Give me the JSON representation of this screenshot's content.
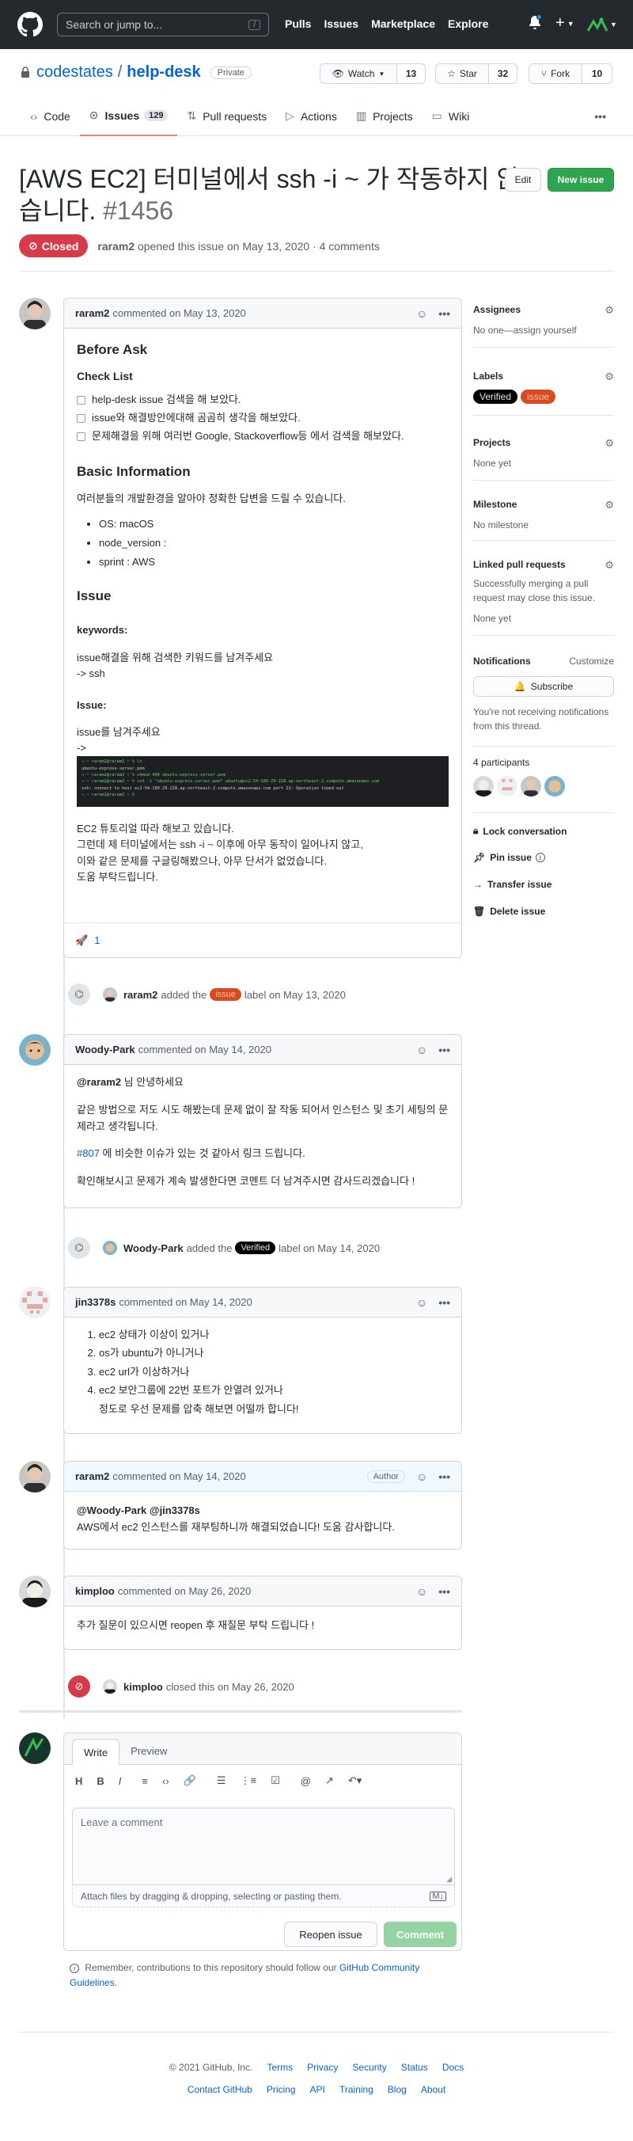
{
  "header": {
    "search_placeholder": "Search or jump to...",
    "search_key": "/",
    "nav": [
      "Pulls",
      "Issues",
      "Marketplace",
      "Explore"
    ]
  },
  "repo": {
    "owner": "codestates",
    "name": "help-desk",
    "visibility": "Private",
    "watch": "Watch",
    "watch_count": "13",
    "star": "Star",
    "star_count": "32",
    "fork": "Fork",
    "fork_count": "10"
  },
  "tabs": [
    {
      "label": "Code"
    },
    {
      "label": "Issues",
      "count": "129"
    },
    {
      "label": "Pull requests"
    },
    {
      "label": "Actions"
    },
    {
      "label": "Projects"
    },
    {
      "label": "Wiki"
    }
  ],
  "issue": {
    "title_line1": "[AWS EC2] 터미널에서 ssh -i ~ 가 작동하지 않",
    "title_line2": "습니다.",
    "number": "#1456",
    "edit": "Edit",
    "new_issue": "New issue",
    "state": "Closed",
    "meta_author": "raram2",
    "meta_rest": "opened this issue on May 13, 2020 · 4 comments"
  },
  "comment1": {
    "author": "raram2",
    "date": "commented on May 13, 2020",
    "h_before": "Before Ask",
    "h_check": "Check List",
    "checks": [
      "help-desk issue 검색을 해 보았다.",
      "issue와 해결방안에대해 곰곰히 생각을 해보았다.",
      "문제해결을 위해 여러번 Google, Stackoverflow등 에서 검색을 해보았다."
    ],
    "h_info": "Basic Information",
    "info_text": "여러분들의 개발환경을 알아야 정확한 답변을 드릴 수 있습니다.",
    "info_items": [
      "OS: macOS",
      "node_version :",
      "sprint : AWS"
    ],
    "h_issue": "Issue",
    "kw_label": "keywords:",
    "kw_text": "issue해결을 위해 검색한 키워드를 남겨주세요",
    "kw_value": "-> ssh",
    "issue_label": "Issue:",
    "issue_text": "issue를 남겨주세요",
    "arrow": "->",
    "term": [
      "→ ~ raram2@raram2 ~ % ls",
      "ubuntu-express-server.pem",
      "→ ~ raram2@raram2 ~ % chmod 400 ubuntu-express-server.pem",
      "→ ~ raram2@raram2 ~ % ssh -i \"ubuntu-express-server.pem\" ubuntu@ec2-54-180-29-228.ap-northeast-2.compute.amazonaws.com",
      "",
      "ssh: connect to host ec2-54-180-29-228.ap-northeast-2.compute.amazonaws.com port 22: Operation timed out",
      "→ ~ raram2@raram2 ~ % "
    ],
    "tail": [
      "EC2 튜토리얼 따라 해보고 있습니다.",
      "그런데 제 터미널에서는 ssh -i ~ 이후에 아무 동작이 일어나지 않고,",
      "이와 같은 문제를 구글링해봤으나, 아무 단서가 없었습니다.",
      "도움 부탁드립니다."
    ],
    "reaction": "🚀",
    "reaction_count": "1"
  },
  "event1": {
    "author": "raram2",
    "pre": "added the",
    "label": "issue",
    "post": "label on May 13, 2020"
  },
  "comment2": {
    "author": "Woody-Park",
    "date": "commented on May 14, 2020",
    "mention": "@raram2",
    "greet": "님 안녕하세요",
    "p1": "같은 방법으로 저도 시도 해봤는데 문제 없이 잘 작동 되어서 인스턴스 및 초기 세팅의 문제라고 생각됩니다.",
    "link": "#807",
    "p2": "에 비슷한 이슈가 있는 것 같아서 링크 드립니다.",
    "p3": "확인해보시고 문제가 계속 발생한다면 코멘트 더 남겨주시면 감사드리겠습니다 !"
  },
  "event2": {
    "author": "Woody-Park",
    "pre": "added the",
    "label": "Verified",
    "post": "label on May 14, 2020"
  },
  "comment3": {
    "author": "jin3378s",
    "date": "commented on May 14, 2020",
    "items": [
      "ec2 상태가 이상이 있거나",
      "os가 ubuntu가 아니거나",
      "ec2 url가 이상하거나",
      "ec2 보안그룹에 22번 포트가 안열려 있거나"
    ],
    "tail": "정도로 우선 문제를 압축 해보면 어떨까 합니다!"
  },
  "comment4": {
    "author": "raram2",
    "date": "commented on May 14, 2020",
    "badge": "Author",
    "mentions": "@Woody-Park @jin3378s",
    "text": "AWS에서 ec2 인스턴스를 재부팅하니까 해결되었습니다! 도움 감사합니다."
  },
  "comment5": {
    "author": "kimploo",
    "date": "commented on May 26, 2020",
    "text": "추가 질문이 있으시면 reopen 후 재질문 부탁 드립니다 !"
  },
  "event3": {
    "author": "kimploo",
    "text": "closed this on May 26, 2020"
  },
  "composer": {
    "tab_write": "Write",
    "tab_preview": "Preview",
    "placeholder": "Leave a comment",
    "attach": "Attach files by dragging & dropping, selecting or pasting them.",
    "reopen": "Reopen issue",
    "comment": "Comment",
    "remember_pre": "Remember, contributions to this repository should follow our",
    "remember_link": "GitHub Community Guidelines",
    "remember_post": "."
  },
  "sidebar": {
    "assignees": "Assignees",
    "assignees_val": "No one—assign yourself",
    "labels": "Labels",
    "label1": "Verified",
    "label2": "issue",
    "projects": "Projects",
    "projects_val": "None yet",
    "milestone": "Milestone",
    "milestone_val": "No milestone",
    "linked": "Linked pull requests",
    "linked_text": "Successfully merging a pull request may close this issue.",
    "linked_val": "None yet",
    "notifications": "Notifications",
    "customize": "Customize",
    "subscribe": "Subscribe",
    "notif_text": "You're not receiving notifications from this thread.",
    "participants": "4 participants",
    "lock": "Lock conversation",
    "pin": "Pin issue",
    "transfer": "Transfer issue",
    "delete": "Delete issue"
  },
  "footer": {
    "copyright": "© 2021 GitHub, Inc.",
    "row1": [
      "Terms",
      "Privacy",
      "Security",
      "Status",
      "Docs"
    ],
    "row2": [
      "Contact GitHub",
      "Pricing",
      "API",
      "Training",
      "Blog",
      "About"
    ]
  },
  "colors": {
    "header": "#24292e",
    "primary": "#2ea44f",
    "closed": "#d73a49",
    "link": "#0366d6",
    "label_issue": "#d94a1f",
    "label_verified": "#000000"
  }
}
